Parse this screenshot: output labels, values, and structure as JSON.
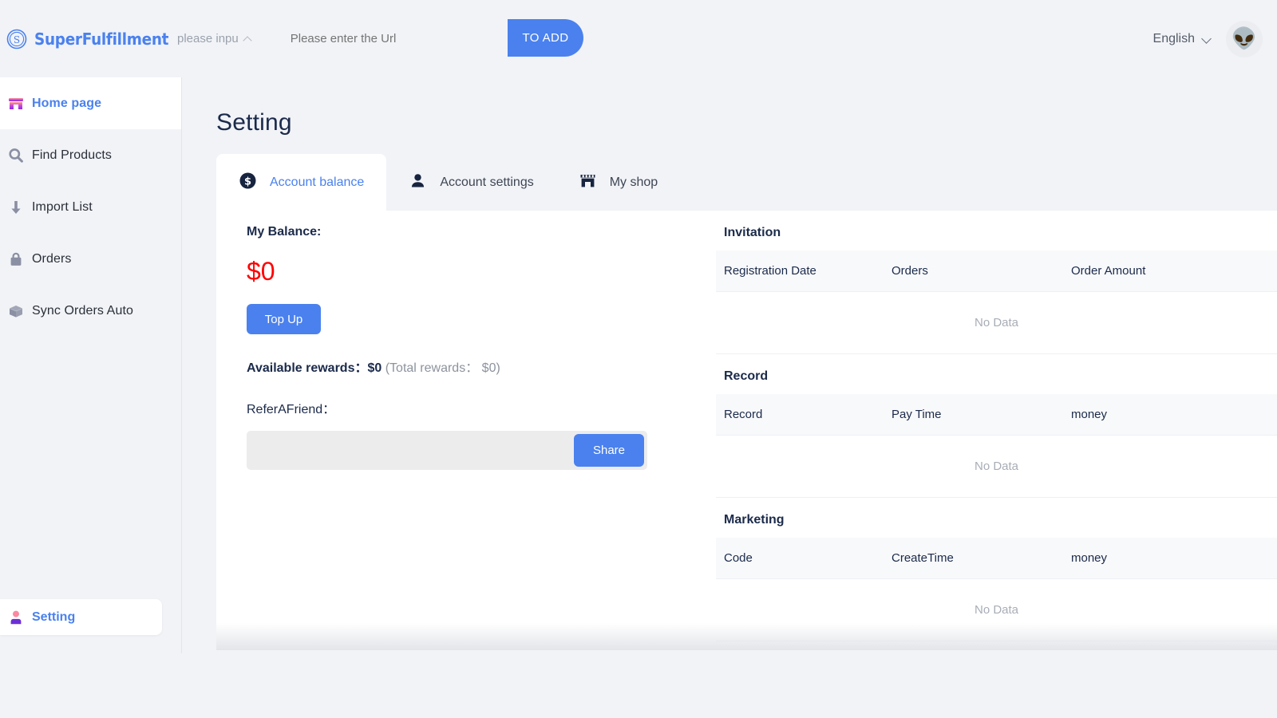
{
  "header": {
    "logo_text": "SuperFulfillment",
    "logo_icon": "s-circle-logo-icon",
    "store_select_value": "please inpu",
    "url_placeholder": "Please enter the Url",
    "url_value": "",
    "add_button": "TO ADD",
    "language": "English",
    "avatar_emoji": "👽"
  },
  "sidebar": {
    "items": [
      {
        "label": "Home page",
        "icon": "store-front-icon",
        "active": true
      },
      {
        "label": "Find Products",
        "icon": "search-icon",
        "active": false
      },
      {
        "label": "Import List",
        "icon": "download-arrow-icon",
        "active": false
      },
      {
        "label": "Orders",
        "icon": "handbag-icon",
        "active": false
      },
      {
        "label": "Sync Orders Auto",
        "icon": "package-box-icon",
        "active": false
      }
    ],
    "setting": {
      "label": "Setting",
      "icon": "user-person-icon"
    }
  },
  "main": {
    "page_title": "Setting",
    "tabs": [
      {
        "label": "Account balance",
        "icon": "dollar-coin-icon",
        "active": true
      },
      {
        "label": "Account settings",
        "icon": "person-icon",
        "active": false
      },
      {
        "label": "My shop",
        "icon": "shop-store-icon",
        "active": false
      }
    ],
    "balance": {
      "label": "My Balance:",
      "value": "$0",
      "value_color": "#ff0000",
      "topup_button": "Top Up",
      "rewards_label": "Available rewards：",
      "rewards_value": "$0",
      "total_rewards_label": " (Total rewards：",
      "total_rewards_value": " $0)",
      "refer_label": "ReferAFriend：",
      "refer_link_value": "",
      "refer_link_placeholder": "",
      "share_button": "Share"
    },
    "tables": [
      {
        "title": "Invitation",
        "columns": [
          "Registration Date",
          "Orders",
          "Order Amount"
        ],
        "rows": [],
        "empty_text": "No Data"
      },
      {
        "title": "Record",
        "columns": [
          "Record",
          "Pay Time",
          "money"
        ],
        "rows": [],
        "empty_text": "No Data"
      },
      {
        "title": "Marketing",
        "columns": [
          "Code",
          "CreateTime",
          "money"
        ],
        "rows": [],
        "empty_text": "No Data"
      }
    ]
  },
  "colors": {
    "accent": "#4a81ee",
    "page_bg": "#f1f3f7",
    "panel_bg": "#ffffff",
    "text_dark": "#1b2a4a",
    "danger": "#ff0000"
  }
}
